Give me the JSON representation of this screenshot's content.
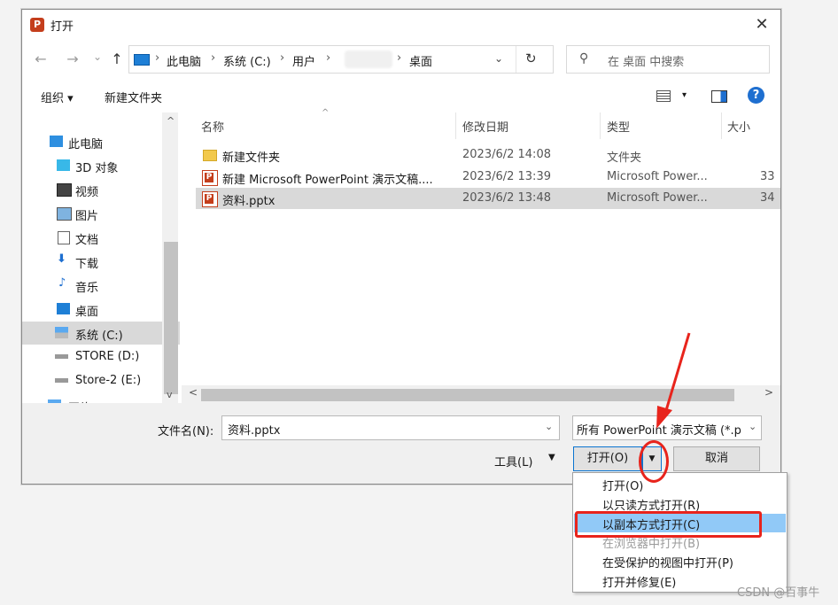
{
  "title": "打开",
  "app_icon": "powerpoint-icon",
  "nav": {
    "back": "←",
    "forward": "→",
    "recent": "⌄",
    "up": "↑"
  },
  "address": {
    "crumbs": [
      "此电脑",
      "系统 (C:)",
      "用户",
      "桌面"
    ],
    "separator": "›"
  },
  "search": {
    "placeholder": "在 桌面 中搜索"
  },
  "toolbar": {
    "organize": "组织 ▾",
    "new_folder": "新建文件夹",
    "view_caret": "▾",
    "help": "?"
  },
  "sidebar": {
    "items": [
      {
        "label": "此电脑",
        "icon": "computer-icon"
      },
      {
        "label": "3D 对象",
        "icon": "cube-icon"
      },
      {
        "label": "视频",
        "icon": "film-icon"
      },
      {
        "label": "图片",
        "icon": "picture-icon"
      },
      {
        "label": "文档",
        "icon": "document-icon"
      },
      {
        "label": "下载",
        "icon": "download-arrow-icon"
      },
      {
        "label": "音乐",
        "icon": "music-note-icon"
      },
      {
        "label": "桌面",
        "icon": "desktop-icon"
      },
      {
        "label": "系统 (C:)",
        "icon": "windows-drive-icon",
        "selected": true
      },
      {
        "label": "STORE (D:)",
        "icon": "drive-icon"
      },
      {
        "label": "Store-2 (E:)",
        "icon": "drive-icon"
      },
      {
        "label": "网络",
        "icon": "network-icon"
      }
    ]
  },
  "columns": [
    "名称",
    "修改日期",
    "类型",
    "大小"
  ],
  "files": [
    {
      "name": "新建文件夹",
      "date": "2023/6/2 14:08",
      "type": "文件夹",
      "size": "",
      "icon": "folder-icon"
    },
    {
      "name": "新建 Microsoft PowerPoint 演示文稿....",
      "date": "2023/6/2 13:39",
      "type": "Microsoft Power...",
      "size": "33",
      "icon": "pptx-file-icon"
    },
    {
      "name": "资料.pptx",
      "date": "2023/6/2 13:48",
      "type": "Microsoft Power...",
      "size": "34",
      "icon": "pptx-file-icon",
      "selected": true
    }
  ],
  "bottom": {
    "filename_label": "文件名(N):",
    "filename_value": "资料.pptx",
    "filter_value": "所有 PowerPoint 演示文稿 (*.p",
    "tools_label": "工具(L)",
    "tools_arrow": "▼",
    "open_label": "打开(O)",
    "open_split_arrow": "▼",
    "cancel_label": "取消"
  },
  "open_menu": [
    {
      "label": "打开(O)"
    },
    {
      "label": "以只读方式打开(R)"
    },
    {
      "label": "以副本方式打开(C)",
      "highlighted": true
    },
    {
      "label": "在浏览器中打开(B)",
      "disabled": true
    },
    {
      "label": "在受保护的视图中打开(P)"
    },
    {
      "label": "打开并修复(E)"
    }
  ],
  "annotation_color": "#e8241c",
  "watermark": "CSDN @百事牛"
}
